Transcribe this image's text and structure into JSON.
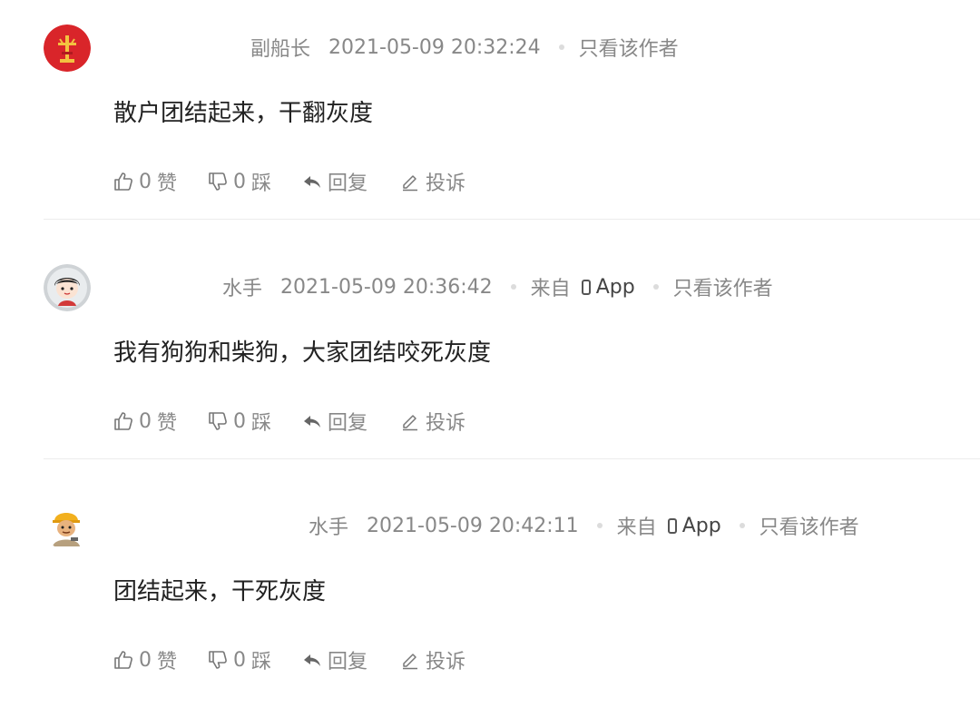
{
  "comments": [
    {
      "author": "副船长",
      "time": "2021-05-09 20:32:24",
      "source_prefix": "",
      "source_app": "",
      "only_author": "只看该作者",
      "content": "散户团结起来，干翻灰度",
      "like_count": "0",
      "like_label": "赞",
      "dislike_count": "0",
      "dislike_label": "踩",
      "reply_label": "回复",
      "report_label": "投诉",
      "avatar": "red-logo-avatar"
    },
    {
      "author": "水手",
      "time": "2021-05-09 20:36:42",
      "source_prefix": "来自",
      "source_app": "App",
      "only_author": "只看该作者",
      "content": "我有狗狗和柴狗，大家团结咬死灰度",
      "like_count": "0",
      "like_label": "赞",
      "dislike_count": "0",
      "dislike_label": "踩",
      "reply_label": "回复",
      "report_label": "投诉",
      "avatar": "cartoon-boy-avatar"
    },
    {
      "author": "水手",
      "time": "2021-05-09 20:42:11",
      "source_prefix": "来自",
      "source_app": "App",
      "only_author": "只看该作者",
      "content": "团结起来，干死灰度",
      "like_count": "0",
      "like_label": "赞",
      "dislike_count": "0",
      "dislike_label": "踩",
      "reply_label": "回复",
      "report_label": "投诉",
      "avatar": "worker-helmet-avatar"
    }
  ],
  "colors": {
    "meta_text": "#888888",
    "content_text": "#222222",
    "divider": "#ececec",
    "avatar1_bg": "#d9252a"
  }
}
